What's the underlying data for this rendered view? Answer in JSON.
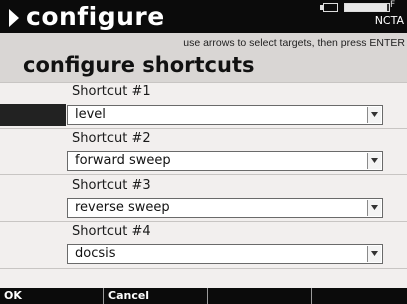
{
  "header": {
    "title": "configure",
    "device_label": "NCTA",
    "battery_level_percent": 95
  },
  "instruction": "use arrows to select targets, then press ENTER",
  "panel_title": "configure shortcuts",
  "shortcuts": [
    {
      "label": "Shortcut #1",
      "value": "level"
    },
    {
      "label": "Shortcut #2",
      "value": "forward sweep"
    },
    {
      "label": "Shortcut #3",
      "value": "reverse sweep"
    },
    {
      "label": "Shortcut #4",
      "value": "docsis"
    }
  ],
  "softkeys": [
    {
      "label": "OK"
    },
    {
      "label": "Cancel"
    },
    {
      "label": ""
    },
    {
      "label": ""
    }
  ]
}
